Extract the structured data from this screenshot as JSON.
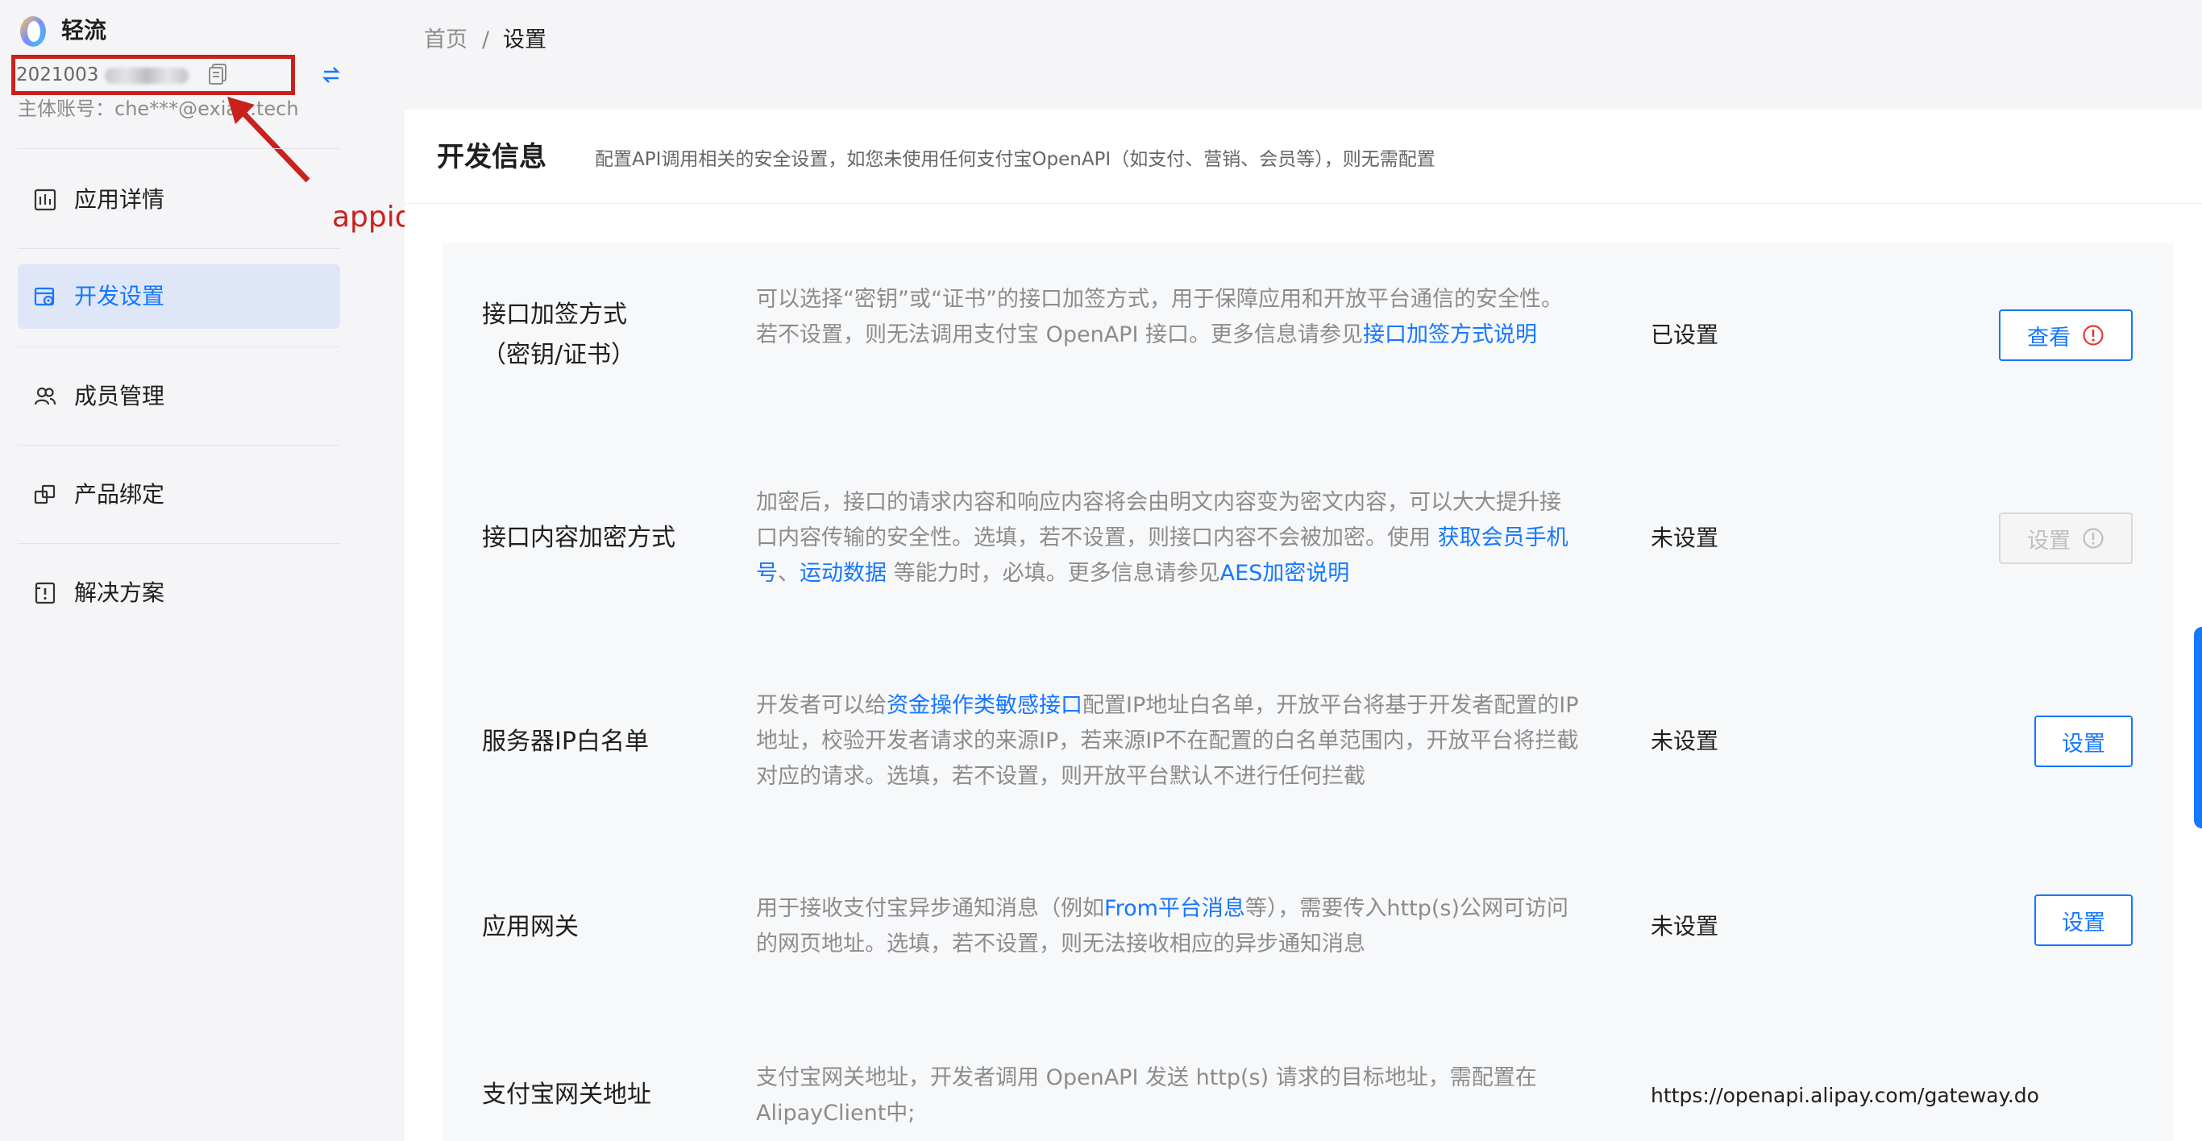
{
  "app": {
    "name": "轻流",
    "appid_prefix": "2021003",
    "appid_suffix_masked": "",
    "account_label": "主体账号：",
    "account_value": "che***@exia...tech"
  },
  "annotation": {
    "label": "appid",
    "color": "#c9211e"
  },
  "sidebar": {
    "items": [
      {
        "label": "应用详情",
        "icon": "chart-icon",
        "active": false
      },
      {
        "label": "开发设置",
        "icon": "settings-gear-icon",
        "active": true
      },
      {
        "label": "成员管理",
        "icon": "users-icon",
        "active": false
      },
      {
        "label": "产品绑定",
        "icon": "link-squares-icon",
        "active": false
      },
      {
        "label": "解决方案",
        "icon": "document-icon",
        "active": false
      }
    ]
  },
  "breadcrumb": {
    "home": "首页",
    "separator": "/",
    "current": "设置"
  },
  "panel": {
    "title": "开发信息",
    "description": "配置API调用相关的安全设置，如您未使用任何支付宝OpenAPI（如支付、营销、会员等），则无需配置"
  },
  "rows": [
    {
      "label_line1": "接口加签方式",
      "label_line2": "（密钥/证书）",
      "desc_a": "可以选择“密钥”或“证书”的接口加签方式，用于保障应用和开放平台通信的安全性。若不设置，则无法调用支付宝 OpenAPI 接口。更多信息请参见",
      "desc_link": "接口加签方式说明",
      "status": "已设置",
      "button": "查看"
    },
    {
      "label": "接口内容加密方式",
      "desc_a": "加密后，接口的请求内容和响应内容将会由明文内容变为密文内容，可以大大提升接口内容传输的安全性。选填，若不设置，则接口内容不会被加密。使用 ",
      "desc_link1": "获取会员手机号",
      "desc_sep": "、",
      "desc_link2": "运动数据",
      "desc_b": " 等能力时，必填。更多信息请参见",
      "desc_link3": "AES加密说明",
      "status": "未设置",
      "button": "设置"
    },
    {
      "label": "服务器IP白名单",
      "desc_a": "开发者可以给",
      "desc_link": "资金操作类敏感接口",
      "desc_b": "配置IP地址白名单，开放平台将基于开发者配置的IP地址，校验开发者请求的来源IP，若来源IP不在配置的白名单范围内，开放平台将拦截对应的请求。选填，若不设置，则开放平台默认不进行任何拦截",
      "status": "未设置",
      "button": "设置"
    },
    {
      "label": "应用网关",
      "desc_a": "用于接收支付宝异步通知消息（例如",
      "desc_link": "From平台消息",
      "desc_b": "等），需要传入http(s)公网可访问的网页地址。选填，若不设置，则无法接收相应的异步通知消息",
      "status": "未设置",
      "button": "设置"
    },
    {
      "label": "支付宝网关地址",
      "desc_a": "支付宝网关地址，开发者调用 OpenAPI 发送 http(s) 请求的目标地址，需配置在AlipayClient中;",
      "value": "https://openapi.alipay.com/gateway.do"
    }
  ],
  "colors": {
    "accent": "#1677ff",
    "annotation_red": "#c9211e",
    "active_nav_bg": "#dfe6f8"
  }
}
